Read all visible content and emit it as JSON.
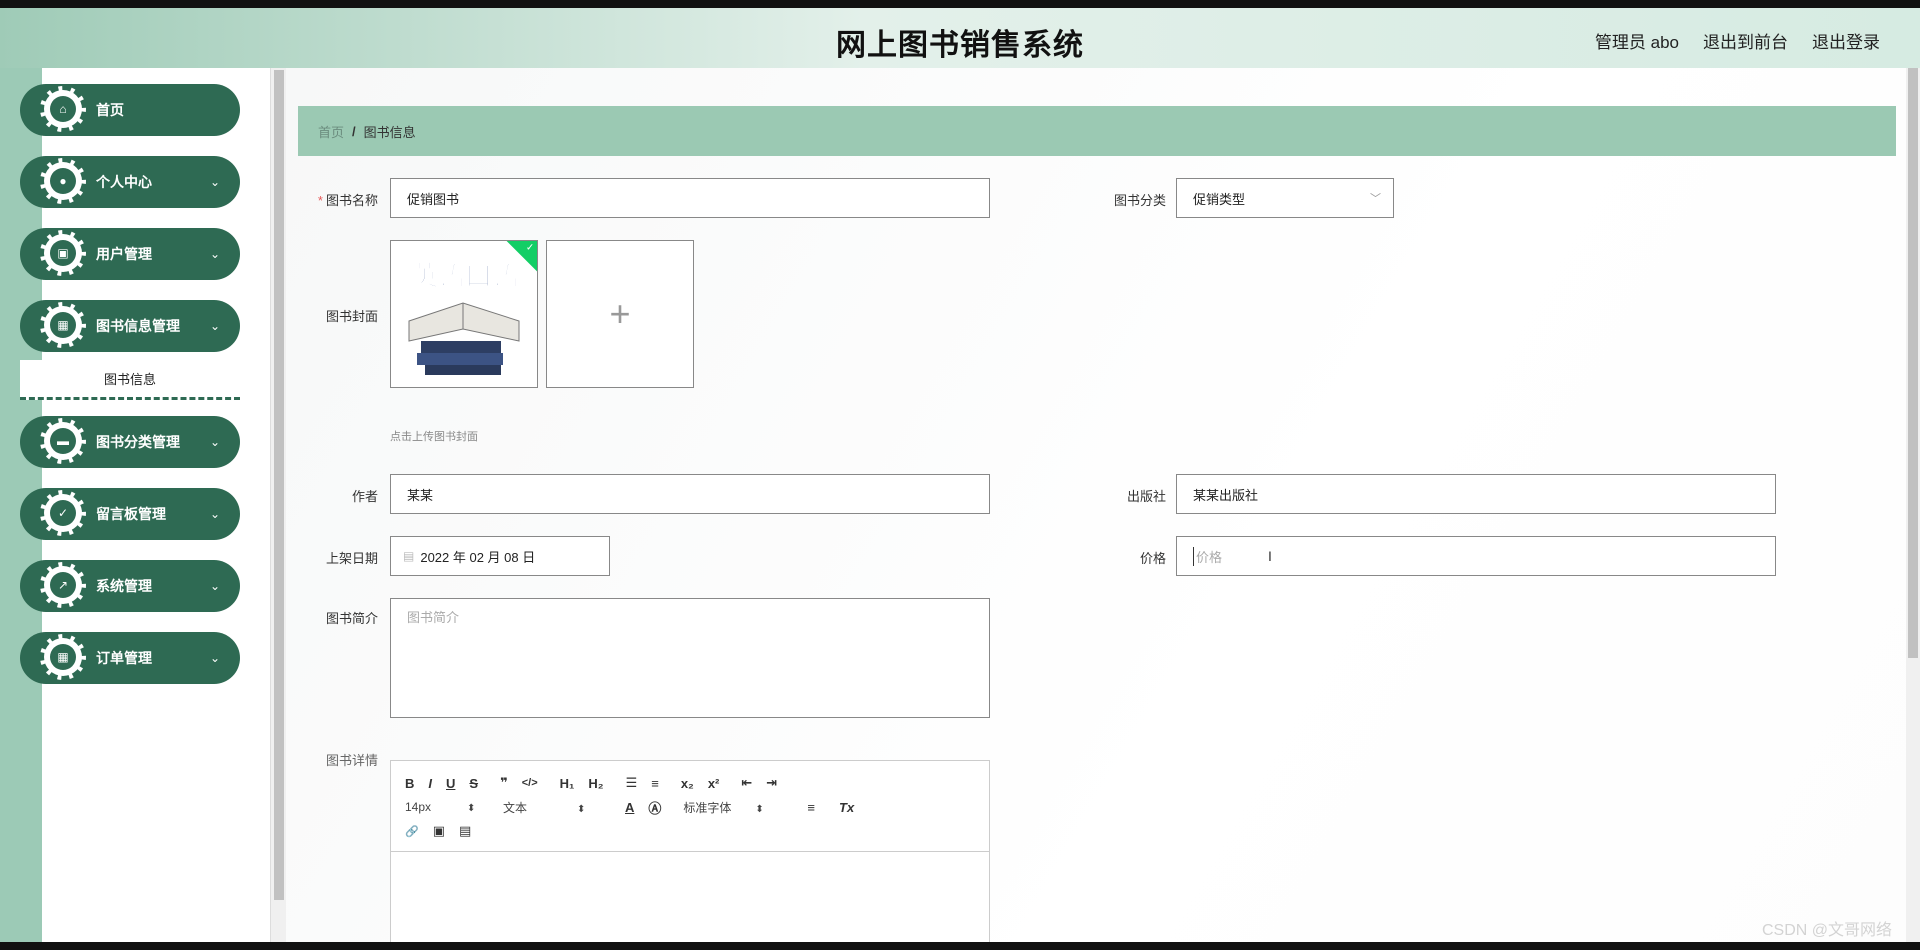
{
  "header": {
    "title": "网上图书销售系统",
    "user_label": "管理员 abo",
    "to_frontend": "退出到前台",
    "logout": "退出登录"
  },
  "sidebar": {
    "items": [
      {
        "label": "首页",
        "icon": "home-icon",
        "chevron": ""
      },
      {
        "label": "个人中心",
        "icon": "user-icon",
        "chevron": "⌄"
      },
      {
        "label": "用户管理",
        "icon": "wallet-icon",
        "chevron": "⌄"
      },
      {
        "label": "图书信息管理",
        "icon": "grid-icon",
        "chevron": "⌄"
      },
      {
        "label": "图书分类管理",
        "icon": "monitor-icon",
        "chevron": "⌄"
      },
      {
        "label": "留言板管理",
        "icon": "clipboard-icon",
        "chevron": "⌄"
      },
      {
        "label": "系统管理",
        "icon": "chart-icon",
        "chevron": "⌄"
      },
      {
        "label": "订单管理",
        "icon": "grid-icon",
        "chevron": "⌄"
      }
    ],
    "submenu_active": "图书信息",
    "accent": "#2e6a53"
  },
  "breadcrumb": {
    "home": "首页",
    "separator": "/",
    "current": "图书信息"
  },
  "form": {
    "name_label": "图书名称",
    "name_value": "促销图书",
    "category_label": "图书分类",
    "category_value": "促销类型",
    "cover_label": "图书封面",
    "cover_image_text": "英语口语",
    "cover_plus": "+",
    "cover_hint": "点击上传图书封面",
    "author_label": "作者",
    "author_value": "某某",
    "publisher_label": "出版社",
    "publisher_value": "某某出版社",
    "date_label": "上架日期",
    "date_value": "2022 年 02 月 08 日",
    "price_label": "价格",
    "price_placeholder": "价格",
    "intro_label": "图书简介",
    "intro_placeholder": "图书简介",
    "detail_label": "图书详情"
  },
  "editor": {
    "row1": [
      "B",
      "I",
      "U",
      "S",
      "❞",
      "</>",
      "H₁",
      "H₂",
      "☰",
      "≡",
      "x₂",
      "x²",
      "⇤",
      "⇥"
    ],
    "font_size": "14px",
    "text_style": "文本",
    "font_family": "标准字体",
    "row2_icons": [
      "A",
      "Ⓐ"
    ],
    "align_icon": "≡",
    "clear_icon": "Tx",
    "row3": [
      "🔗",
      "▣",
      "▤"
    ]
  },
  "watermark": "CSDN @文哥网络"
}
